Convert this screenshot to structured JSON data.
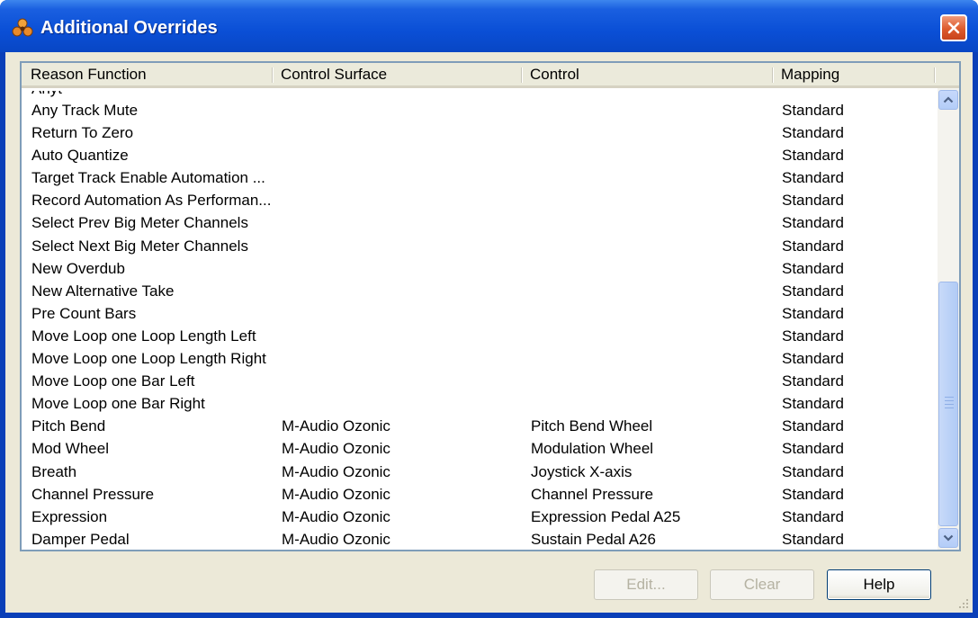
{
  "window": {
    "title": "Additional Overrides"
  },
  "columns": [
    "Reason Function",
    "Control Surface",
    "Control",
    "Mapping"
  ],
  "partial_top_row": "Anyt",
  "rows": [
    {
      "function": "Any Track Mute",
      "surface": "",
      "control": "",
      "mapping": "Standard"
    },
    {
      "function": "Return To Zero",
      "surface": "",
      "control": "",
      "mapping": "Standard"
    },
    {
      "function": "Auto Quantize",
      "surface": "",
      "control": "",
      "mapping": "Standard"
    },
    {
      "function": "Target Track Enable Automation ...",
      "surface": "",
      "control": "",
      "mapping": "Standard"
    },
    {
      "function": "Record Automation As Performan...",
      "surface": "",
      "control": "",
      "mapping": "Standard"
    },
    {
      "function": "Select Prev Big Meter Channels",
      "surface": "",
      "control": "",
      "mapping": "Standard"
    },
    {
      "function": "Select Next Big Meter Channels",
      "surface": "",
      "control": "",
      "mapping": "Standard"
    },
    {
      "function": "New Overdub",
      "surface": "",
      "control": "",
      "mapping": "Standard"
    },
    {
      "function": "New Alternative Take",
      "surface": "",
      "control": "",
      "mapping": "Standard"
    },
    {
      "function": "Pre Count Bars",
      "surface": "",
      "control": "",
      "mapping": "Standard"
    },
    {
      "function": "Move Loop one Loop Length Left",
      "surface": "",
      "control": "",
      "mapping": "Standard"
    },
    {
      "function": "Move Loop one Loop Length Right",
      "surface": "",
      "control": "",
      "mapping": "Standard"
    },
    {
      "function": "Move Loop one Bar Left",
      "surface": "",
      "control": "",
      "mapping": "Standard"
    },
    {
      "function": "Move Loop one Bar Right",
      "surface": "",
      "control": "",
      "mapping": "Standard"
    },
    {
      "function": "Pitch Bend",
      "surface": "M-Audio Ozonic",
      "control": "Pitch Bend Wheel",
      "mapping": "Standard"
    },
    {
      "function": "Mod Wheel",
      "surface": "M-Audio Ozonic",
      "control": "Modulation Wheel",
      "mapping": "Standard"
    },
    {
      "function": "Breath",
      "surface": "M-Audio Ozonic",
      "control": "Joystick X-axis",
      "mapping": "Standard"
    },
    {
      "function": "Channel Pressure",
      "surface": "M-Audio Ozonic",
      "control": "Channel Pressure",
      "mapping": "Standard"
    },
    {
      "function": "Expression",
      "surface": "M-Audio Ozonic",
      "control": "Expression Pedal A25",
      "mapping": "Standard"
    },
    {
      "function": "Damper Pedal",
      "surface": "M-Audio Ozonic",
      "control": "Sustain Pedal A26",
      "mapping": "Standard"
    }
  ],
  "buttons": {
    "edit": "Edit...",
    "clear": "Clear",
    "help": "Help"
  },
  "colors": {
    "title_bar": "#0a4fd6",
    "close_button": "#dd5a2c",
    "dialog_face": "#ece9d8",
    "list_border": "#7f9db9",
    "disabled_text": "#b5b2a2"
  },
  "icons": {
    "app": "reason-app-icon",
    "close": "close-icon",
    "scroll_up": "chevron-up-icon",
    "scroll_down": "chevron-down-icon",
    "resize": "resize-grip-icon"
  }
}
